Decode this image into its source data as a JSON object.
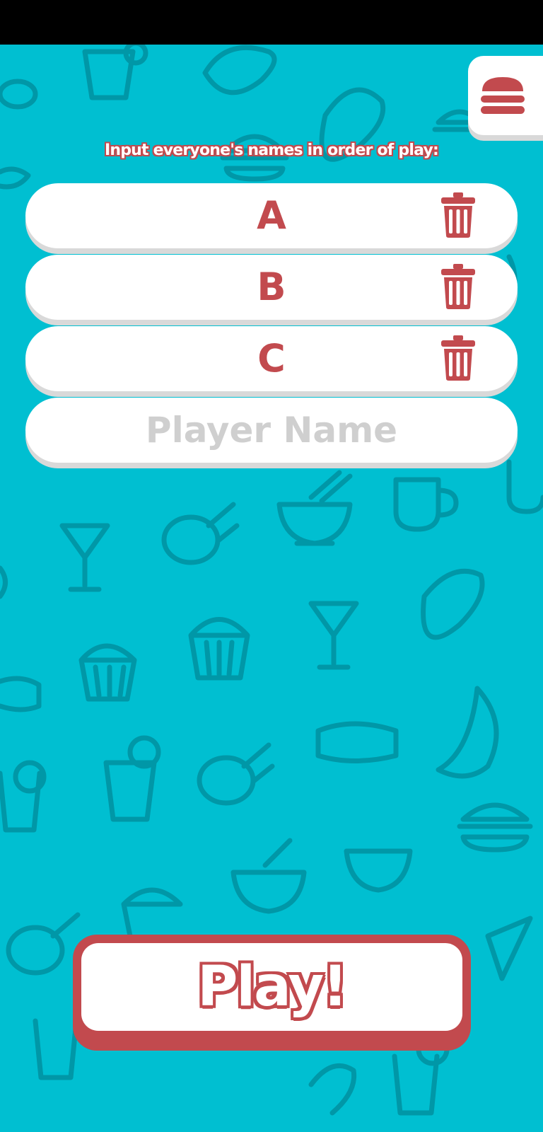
{
  "menu": {
    "icon": "burger-icon"
  },
  "instruction": "Input everyone's names in order of play:",
  "players": [
    {
      "name": "A",
      "delete_icon": "trash-icon"
    },
    {
      "name": "B",
      "delete_icon": "trash-icon"
    },
    {
      "name": "C",
      "delete_icon": "trash-icon"
    }
  ],
  "new_player": {
    "placeholder": "Player Name",
    "value": ""
  },
  "play_button": {
    "label": "Play!"
  },
  "colors": {
    "background": "#00BFD1",
    "pattern": "#0097A7",
    "accent_red": "#C24A4E",
    "placeholder_gray": "#CFCFCF",
    "card_white": "#FFFFFF"
  }
}
